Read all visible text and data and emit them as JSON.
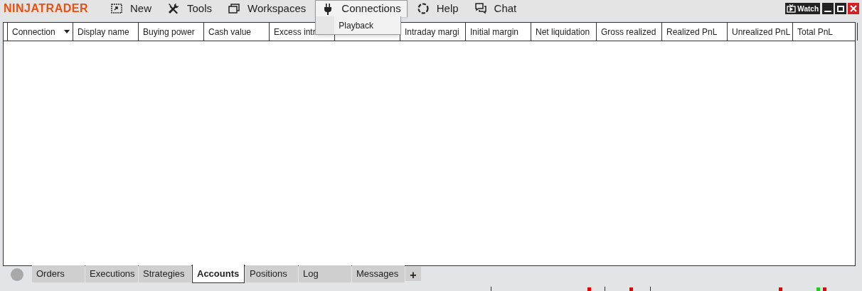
{
  "logo": "NINJATRADER",
  "menu": [
    {
      "label": "New",
      "open": false
    },
    {
      "label": "Tools",
      "open": false
    },
    {
      "label": "Workspaces",
      "open": false
    },
    {
      "label": "Connections",
      "open": true
    },
    {
      "label": "Help",
      "open": false
    },
    {
      "label": "Chat",
      "open": false
    }
  ],
  "connections_menu": {
    "items": [
      "Playback"
    ]
  },
  "watch_button": "Watch",
  "table": {
    "columns": [
      {
        "label": "Connection",
        "filter": true
      },
      {
        "label": "Display name",
        "filter": false
      },
      {
        "label": "Buying power",
        "filter": false
      },
      {
        "label": "Cash value",
        "filter": false
      },
      {
        "label": "Excess intr",
        "filter": false
      },
      {
        "label": "Intraday margi",
        "filter": false
      },
      {
        "label": "Initial margin",
        "filter": false
      },
      {
        "label": "Net liquidation",
        "filter": false
      },
      {
        "label": "Gross realized",
        "filter": false
      },
      {
        "label": "Realized PnL",
        "filter": false
      },
      {
        "label": "Unrealized PnL",
        "filter": false
      },
      {
        "label": "Total PnL",
        "filter": false
      }
    ]
  },
  "tabs": [
    {
      "label": "Orders",
      "selected": false
    },
    {
      "label": "Executions",
      "selected": false
    },
    {
      "label": "Strategies",
      "selected": false
    },
    {
      "label": "Accounts",
      "selected": true
    },
    {
      "label": "Positions",
      "selected": false
    },
    {
      "label": "Log",
      "selected": false
    },
    {
      "label": "Messages",
      "selected": false
    }
  ],
  "add_tab": "+"
}
